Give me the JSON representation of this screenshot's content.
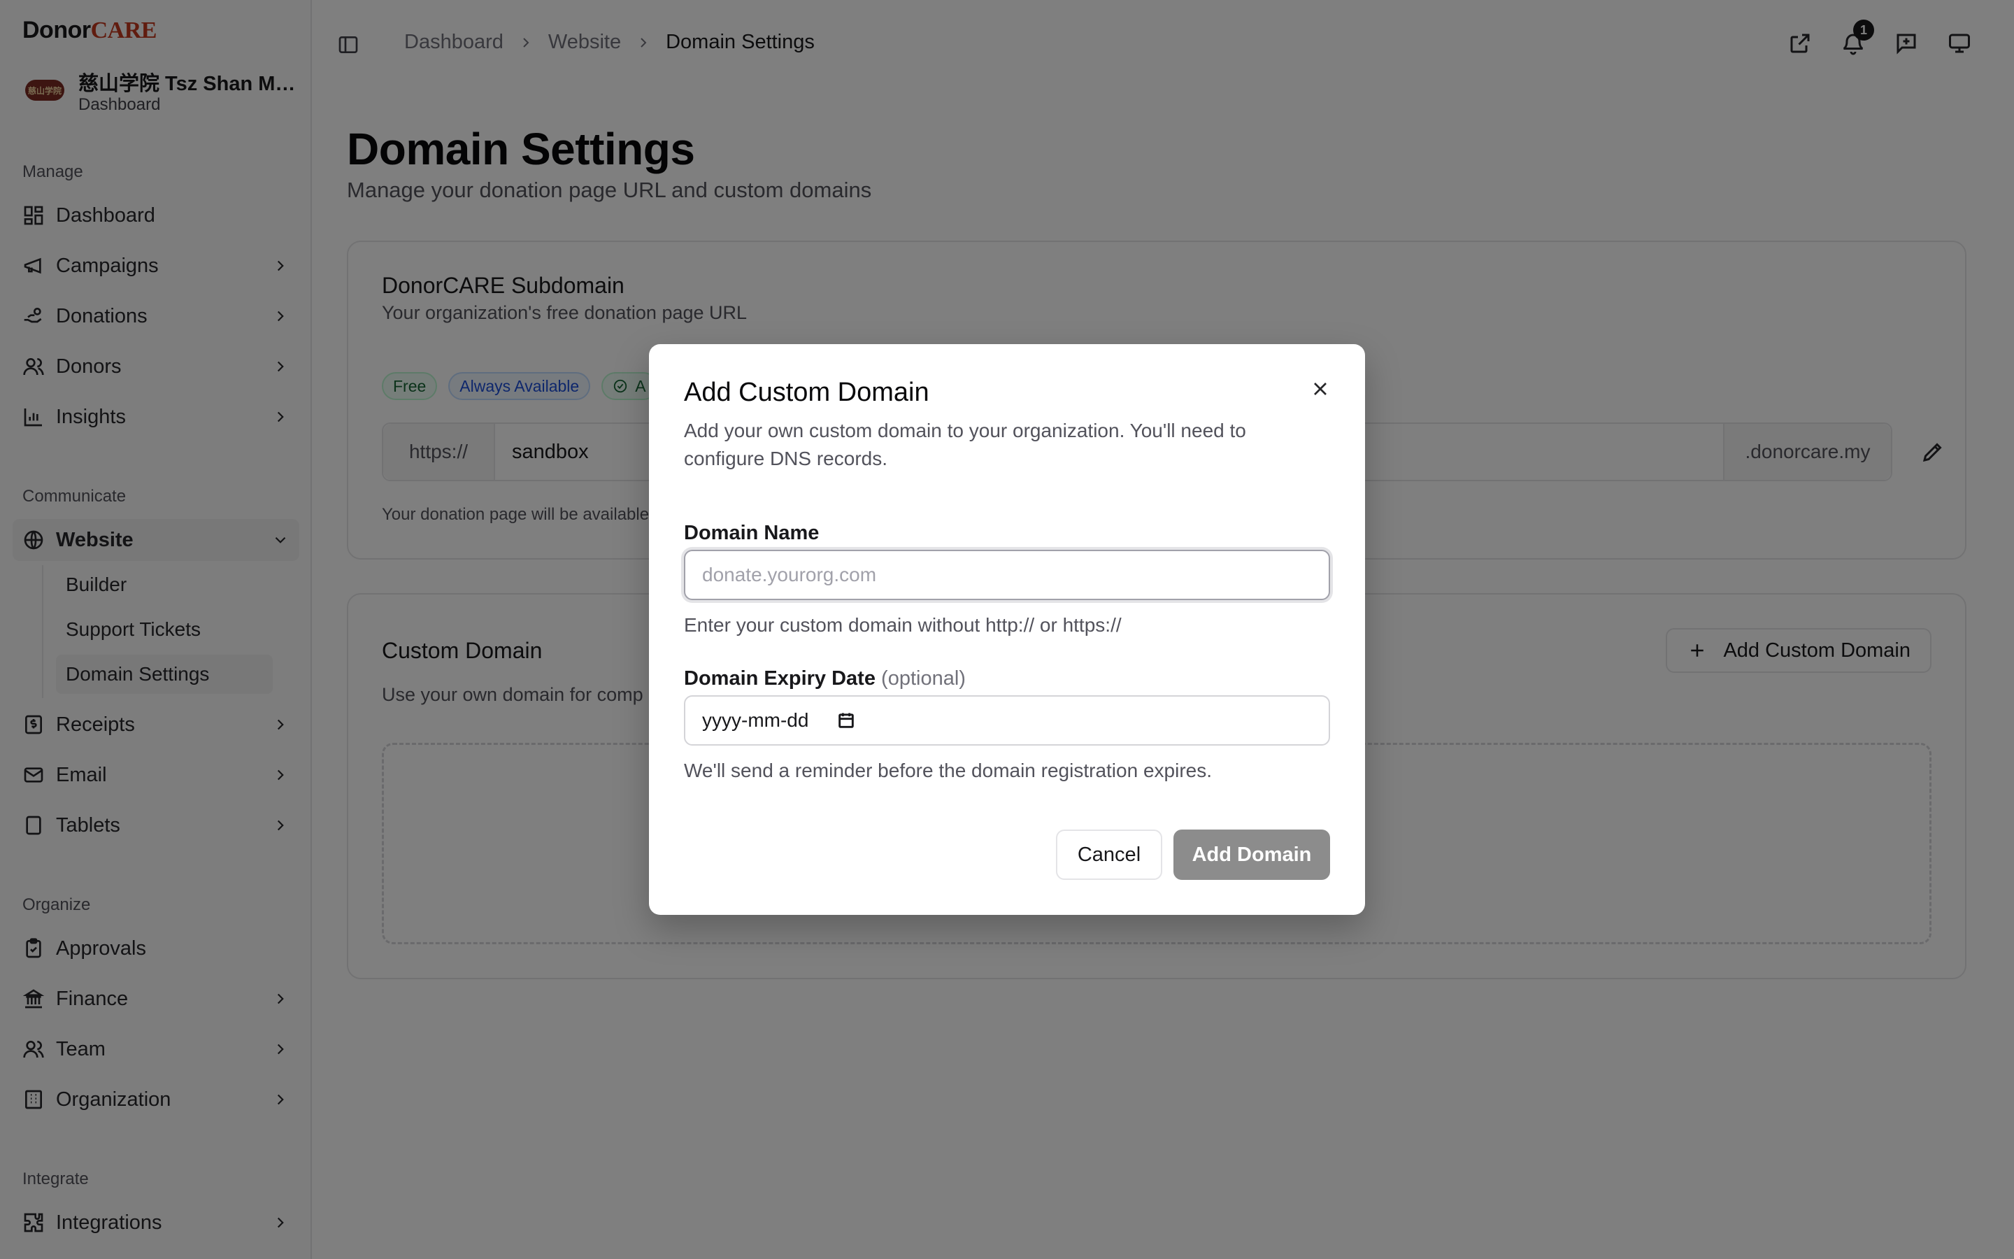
{
  "brand": {
    "part1": "Donor",
    "part2": "CARE"
  },
  "org": {
    "logo_text": "慈山学院",
    "name": "慈山学院 Tsz Shan Monastery",
    "subtitle": "Dashboard"
  },
  "sidebar": {
    "sections": {
      "manage": "Manage",
      "communicate": "Communicate",
      "organize": "Organize",
      "integrate": "Integrate"
    },
    "items": {
      "dashboard": "Dashboard",
      "campaigns": "Campaigns",
      "donations": "Donations",
      "donors": "Donors",
      "insights": "Insights",
      "website": "Website",
      "builder": "Builder",
      "support_tickets": "Support Tickets",
      "domain_settings": "Domain Settings",
      "receipts": "Receipts",
      "email": "Email",
      "tablets": "Tablets",
      "approvals": "Approvals",
      "finance": "Finance",
      "team": "Team",
      "organization": "Organization",
      "integrations": "Integrations"
    }
  },
  "breadcrumb": [
    "Dashboard",
    "Website",
    "Domain Settings"
  ],
  "topbar": {
    "notification_count": "1"
  },
  "page": {
    "title": "Domain Settings",
    "subtitle": "Manage your donation page URL and custom domains"
  },
  "subdomain_card": {
    "title": "DonorCARE Subdomain",
    "description": "Your organization's free donation page URL",
    "chips": {
      "free": "Free",
      "always": "Always Available",
      "active": "A"
    },
    "url_prefix": "https://",
    "url_value": "sandbox",
    "url_suffix": ".donorcare.my",
    "note": "Your donation page will be available"
  },
  "custom_card": {
    "title": "Custom Domain",
    "description": "Use your own domain for comp",
    "add_button": "Add Custom Domain"
  },
  "modal": {
    "title": "Add Custom Domain",
    "description": "Add your own custom domain to your organization. You'll need to configure DNS records.",
    "domain_label": "Domain Name",
    "domain_placeholder": "donate.yourorg.com",
    "domain_help": "Enter your custom domain without http:// or https://",
    "expiry_label": "Domain Expiry Date",
    "expiry_optional": "(optional)",
    "expiry_placeholder": "yyyy-mm-dd",
    "expiry_help": "We'll send a reminder before the domain registration expires.",
    "cancel": "Cancel",
    "submit": "Add Domain"
  }
}
